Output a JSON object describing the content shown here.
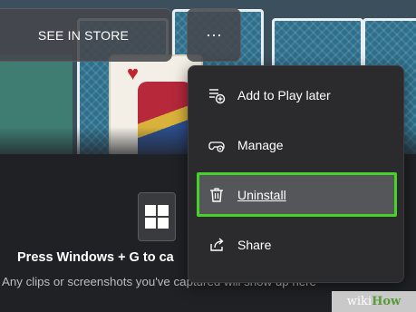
{
  "header": {
    "store_button_label": "SEE IN STORE",
    "more_button_label": "···"
  },
  "menu": {
    "items": [
      {
        "label": "Add to Play later",
        "icon": "add-to-play-later-icon"
      },
      {
        "label": "Manage",
        "icon": "gear-controller-icon"
      },
      {
        "label": "Uninstall",
        "icon": "trash-icon",
        "highlighted": true
      },
      {
        "label": "Share",
        "icon": "share-icon"
      }
    ]
  },
  "content": {
    "press_text": "Press Windows + G to ca",
    "clips_text": "Any clips or screenshots you've captured will show up here"
  },
  "colors": {
    "highlight_border": "#45d32a",
    "menu_bg": "#2b2b2d",
    "page_bg": "#202124"
  },
  "watermark": {
    "prefix": "wiki",
    "suffix": "How"
  }
}
